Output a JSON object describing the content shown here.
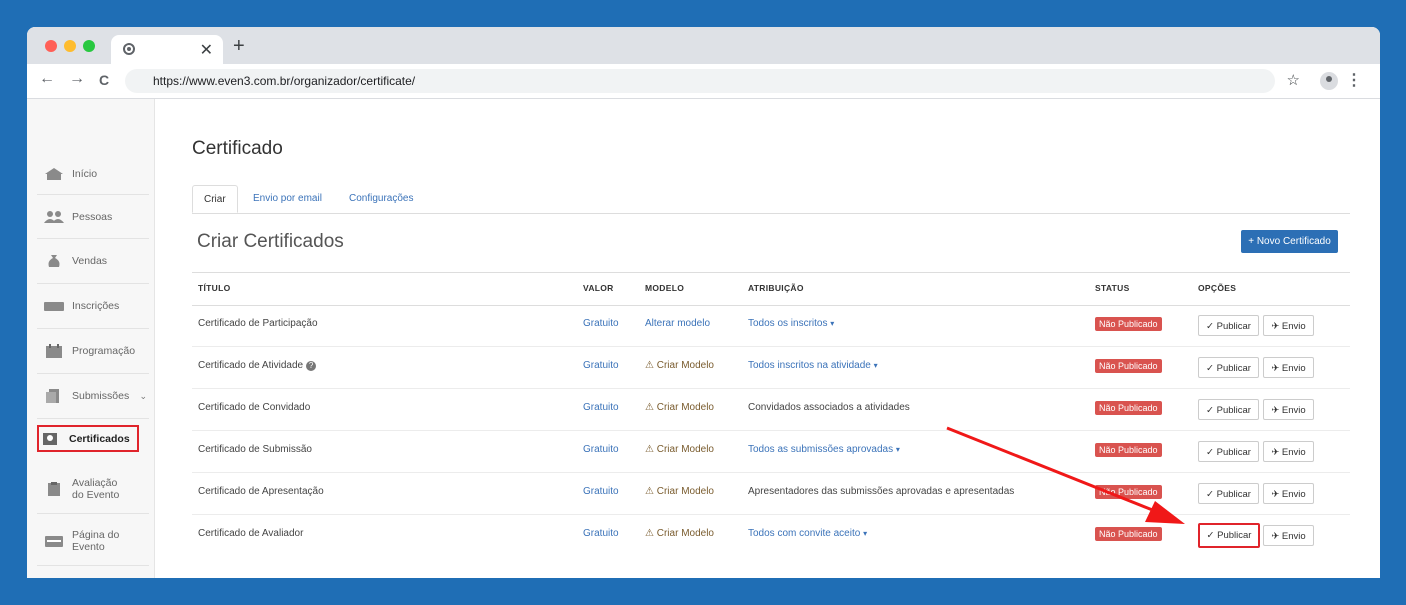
{
  "browser": {
    "tab_close": "✕",
    "new_tab": "+",
    "url": "https://www.even3.com.br/organizador/certificate/",
    "back": "←",
    "forward": "→",
    "reload": "C",
    "star": "☆",
    "menu": "⋮"
  },
  "sidebar": {
    "items": [
      {
        "label": "Início",
        "icon": "home-icon"
      },
      {
        "label": "Pessoas",
        "icon": "people-icon"
      },
      {
        "label": "Vendas",
        "icon": "money-bag-icon"
      },
      {
        "label": "Inscrições",
        "icon": "ticket-icon"
      },
      {
        "label": "Programação",
        "icon": "calendar-icon"
      },
      {
        "label": "Submissões",
        "icon": "document-icon",
        "chevron": "⌄"
      },
      {
        "label": "Certificados",
        "icon": "certificate-icon"
      },
      {
        "label": "Avaliação do Evento",
        "line1": "Avaliação",
        "line2": "do Evento",
        "icon": "clipboard-icon"
      },
      {
        "label": "Página do Evento",
        "line1": "Página do",
        "line2": "Evento",
        "icon": "webpage-icon"
      }
    ]
  },
  "page": {
    "title": "Certificado",
    "tabs": [
      "Criar",
      "Envio por email",
      "Configurações"
    ],
    "section_title": "Criar Certificados",
    "new_button": "+ Novo Certificado",
    "columns": [
      "TÍTULO",
      "VALOR",
      "MODELO",
      "ATRIBUIÇÃO",
      "STATUS",
      "OPÇÕES"
    ],
    "rows": [
      {
        "title": "Certificado de Participação",
        "value": "Gratuito",
        "model": "Alterar modelo",
        "assignment": "Todos os inscritos",
        "status": "Não Publicado"
      },
      {
        "title": "Certificado de Atividade",
        "help": "?",
        "value": "Gratuito",
        "model": "Criar Modelo",
        "assignment": "Todos inscritos na atividade",
        "status": "Não Publicado"
      },
      {
        "title": "Certificado de Convidado",
        "value": "Gratuito",
        "model": "Criar Modelo",
        "assignment": "Convidados associados a atividades",
        "status": "Não Publicado"
      },
      {
        "title": "Certificado de Submissão",
        "value": "Gratuito",
        "model": "Criar Modelo",
        "assignment": "Todos as submissões aprovadas",
        "status": "Não Publicado"
      },
      {
        "title": "Certificado de Apresentação",
        "value": "Gratuito",
        "model": "Criar Modelo",
        "assignment": "Apresentadores das submissões aprovadas e apresentadas",
        "status": "Não Publicado"
      },
      {
        "title": "Certificado de Avaliador",
        "value": "Gratuito",
        "model": "Criar Modelo",
        "assignment": "Todos com convite aceito",
        "status": "Não Publicado"
      }
    ],
    "publish_label": "✓ Publicar",
    "send_label": "✈ Envio",
    "warn_icon": "⚠",
    "dropdown_caret": "▾"
  },
  "colors": {
    "accent": "#2c6fb5",
    "danger": "#d9534f",
    "highlight": "#e0242b",
    "background": "#1f6eb5"
  }
}
